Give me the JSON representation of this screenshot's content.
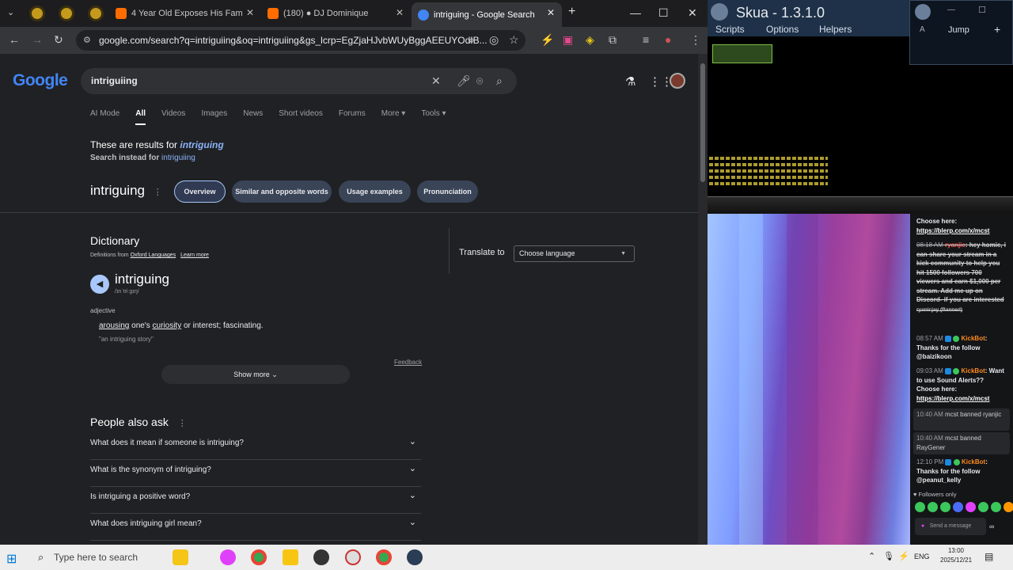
{
  "browser": {
    "tabs": [
      {
        "label": "4 Year Old Exposes His Fam",
        "favicon_color": "#ff6d00"
      },
      {
        "label": "(180) ● DJ Dominique",
        "favicon_color": "#ff6d00"
      },
      {
        "label": "intriguing - Google Search",
        "favicon_color": "#4285f4"
      }
    ],
    "url": "google.com/search?q=intriguiing&oq=intriguiing&gs_lcrp=EgZjaHJvbWUyBggAEEUYOdIB..."
  },
  "google": {
    "logo": "Google",
    "query": "intriguiing",
    "nav_tabs": [
      "AI Mode",
      "All",
      "Videos",
      "Images",
      "News",
      "Short videos",
      "Forums",
      "More ▾",
      "Tools ▾"
    ],
    "results_for_prefix": "These are results for ",
    "results_for_word": "intriguing",
    "search_instead_prefix": "Search instead for ",
    "search_instead_word": "intriguiing",
    "word_title": "intriguing",
    "chips": [
      "Overview",
      "Similar and opposite words",
      "Usage examples",
      "Pronunciation"
    ],
    "dictionary": {
      "heading": "Dictionary",
      "source_prefix": "Definitions from ",
      "source_name": "Oxford Languages",
      "learn_more": "Learn more",
      "headword": "intriguing",
      "pronunciation": "/ɪnˈtriːɡɪŋ/",
      "part_of_speech": "adjective",
      "def_word1": "arousing",
      "def_mid1": " one's ",
      "def_word2": "curiosity",
      "def_rest": " or interest; fascinating.",
      "example": "\"an intriguing story\"",
      "feedback": "Feedback",
      "show_more": "Show more  ⌄"
    },
    "translate": {
      "label": "Translate to",
      "select": "Choose language"
    },
    "people_also_ask": {
      "heading": "People also ask",
      "questions": [
        "What does it mean if someone is intriguing?",
        "What is the synonym of intriguing?",
        "Is intriguing a positive word?",
        "What does intriguing girl mean?"
      ]
    }
  },
  "skua": {
    "title": "Skua - 1.3.1.0",
    "menu": [
      "Scripts",
      "Options",
      "Helpers"
    ],
    "mini_menu": [
      "Jump"
    ]
  },
  "chat": {
    "messages": [
      {
        "text": "Choose here:"
      },
      {
        "link": "https://blerp.com/x/mcst"
      },
      {
        "time": "08:18 AM",
        "user": "ryanjic",
        "text": ": hey homie, i can share your stream in a kick community to help you hit 1500 followers 700 viewers and earn $1,000 per stream. Add me up on Discord- if you are interested",
        "suffix": "ryanicjay (Banned)"
      },
      {
        "time": "08:57 AM",
        "user": "KickBot",
        "text": ": Thanks for the follow @baizikoon"
      },
      {
        "time": "09:03 AM",
        "user": "KickBot",
        "text": ": Want to use Sound Alerts?? Choose here:",
        "link": "https://blerp.com/x/mcst"
      },
      {
        "time": "10:40 AM",
        "text": "mcst banned ryanjic"
      },
      {
        "time": "10:40 AM",
        "text": "mcst banned RayGener"
      },
      {
        "time": "12:10 PM",
        "user": "KickBot",
        "text": ": Thanks for the follow @peanut_kelly"
      }
    ],
    "followers_only": "♥ Followers only",
    "send_placeholder": "Send a message"
  },
  "taskbar": {
    "search_placeholder": "Type here to search",
    "lang": "ENG",
    "time": "13:00",
    "date": "2025/12/21"
  }
}
